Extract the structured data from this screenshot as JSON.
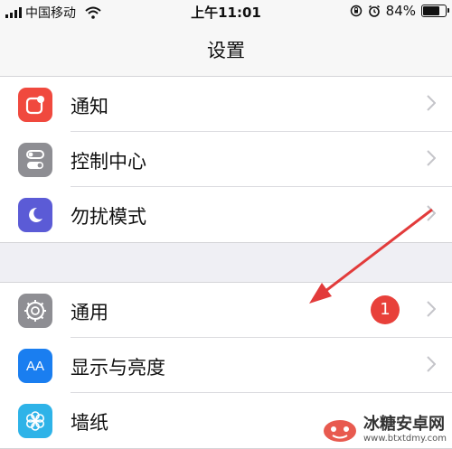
{
  "status_bar": {
    "carrier": "中国移动",
    "time": "上午11:01",
    "battery_percent_text": "84%",
    "battery_level": 0.84
  },
  "nav": {
    "title": "设置"
  },
  "groups": [
    {
      "items": [
        {
          "label": "通知",
          "icon": "notifications-icon",
          "color": "#f0493e"
        },
        {
          "label": "控制中心",
          "icon": "control-center-icon",
          "color": "#8e8e93"
        },
        {
          "label": "勿扰模式",
          "icon": "moon-icon",
          "color": "#5b5bd6"
        }
      ]
    },
    {
      "items": [
        {
          "label": "通用",
          "icon": "gear-icon",
          "color": "#8e8e93",
          "badge": "1"
        },
        {
          "label": "显示与亮度",
          "icon": "display-brightness-icon",
          "color": "#1a7ef0",
          "icon_text": "AA"
        },
        {
          "label": "墙纸",
          "icon": "wallpaper-flower-icon",
          "color": "#2eb3e8"
        }
      ]
    }
  ],
  "watermark": {
    "name": "冰糖安卓网",
    "url": "www.btxtdmy.com"
  },
  "colors": {
    "arrow": "#e23b3b",
    "badge": "#e8403a"
  }
}
